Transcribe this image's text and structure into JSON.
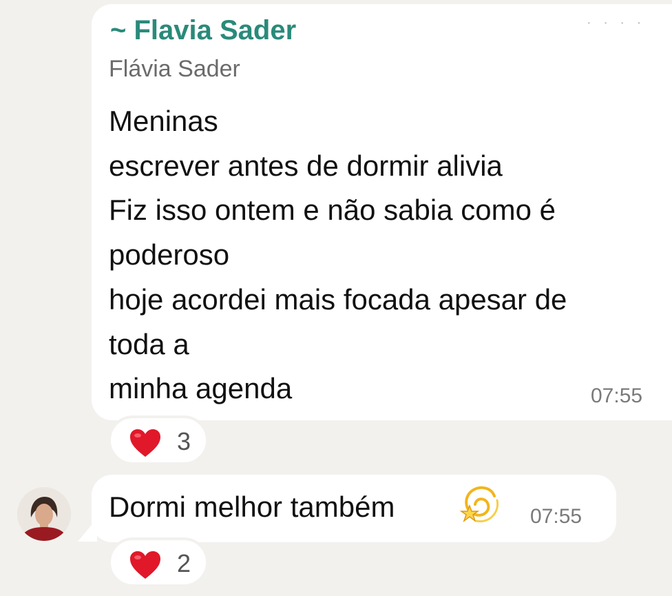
{
  "messages": [
    {
      "sender": "~ Flavia Sader",
      "push_name": "Flávia Sader",
      "lines": [
        "Meninas",
        "escrever antes de dormir alivia",
        "Fiz isso ontem e não sabia como é",
        "poderoso",
        "hoje acordei mais focada apesar de",
        "toda a",
        "minha agenda"
      ],
      "time": "07:55",
      "reaction": {
        "icon": "heart-icon",
        "count": "3"
      }
    },
    {
      "text": "Dormi melhor também",
      "emoji": "dizzy-icon",
      "time": "07:55",
      "reaction": {
        "icon": "heart-icon",
        "count": "2"
      }
    }
  ],
  "colors": {
    "background": "#f2f1ee",
    "bubble": "#ffffff",
    "sender_name": "#2a8a7a",
    "heart": "#e0182a",
    "timestamp": "#7a7a7a"
  }
}
